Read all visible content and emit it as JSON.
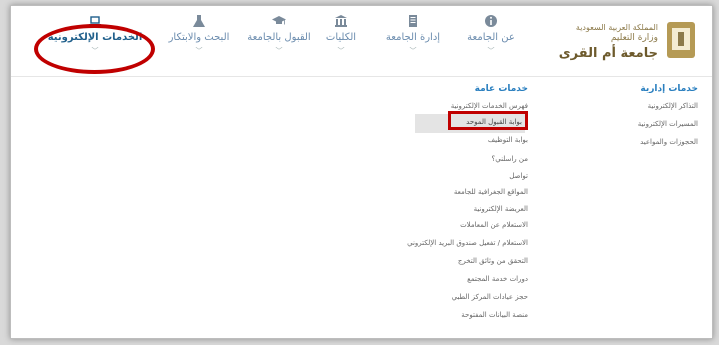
{
  "logo": {
    "line1": "المملكة العربية السعودية",
    "line2": "وزارة التعليم",
    "line3": "جامعة أم القرى"
  },
  "nav": [
    {
      "label": "عن الجامعة",
      "icon": "info-icon"
    },
    {
      "label": "إدارة الجامعة",
      "icon": "document-icon"
    },
    {
      "label": "الكليات",
      "icon": "building-icon"
    },
    {
      "label": "القبول بالجامعة",
      "icon": "graduation-cap-icon"
    },
    {
      "label": "البحث والابتكار",
      "icon": "flask-icon"
    },
    {
      "label": "الخدمات الإلكترونية",
      "icon": "laptop-icon",
      "active": true
    }
  ],
  "admin": {
    "title": "خدمات إدارية",
    "items": [
      "التذاكر الإلكترونية",
      "المسيرات الإلكترونية",
      "الحجوزات والمواعيد"
    ]
  },
  "general": {
    "title": "خدمات عامة",
    "items": [
      "فهرس الخدمات الإلكترونية",
      "بوابة القبول الموحد",
      "بوابة التوظيف",
      "من راسلني؟",
      "تواصل",
      "المواقع الجغرافية للجامعة",
      "العريضة الإلكترونية",
      "الاستعلام عن المعاملات",
      "الاستعلام / تفعيل صندوق البريد الإلكتروني",
      "التحقق من وثائق التخرج",
      "دورات خدمة المجتمع",
      "حجز عيادات المركز الطبي",
      "منصة البيانات المفتوحة"
    ]
  },
  "colors": {
    "accent": "#2a7fbf",
    "annotation": "#c00000",
    "nav_text": "#6b8cae"
  }
}
